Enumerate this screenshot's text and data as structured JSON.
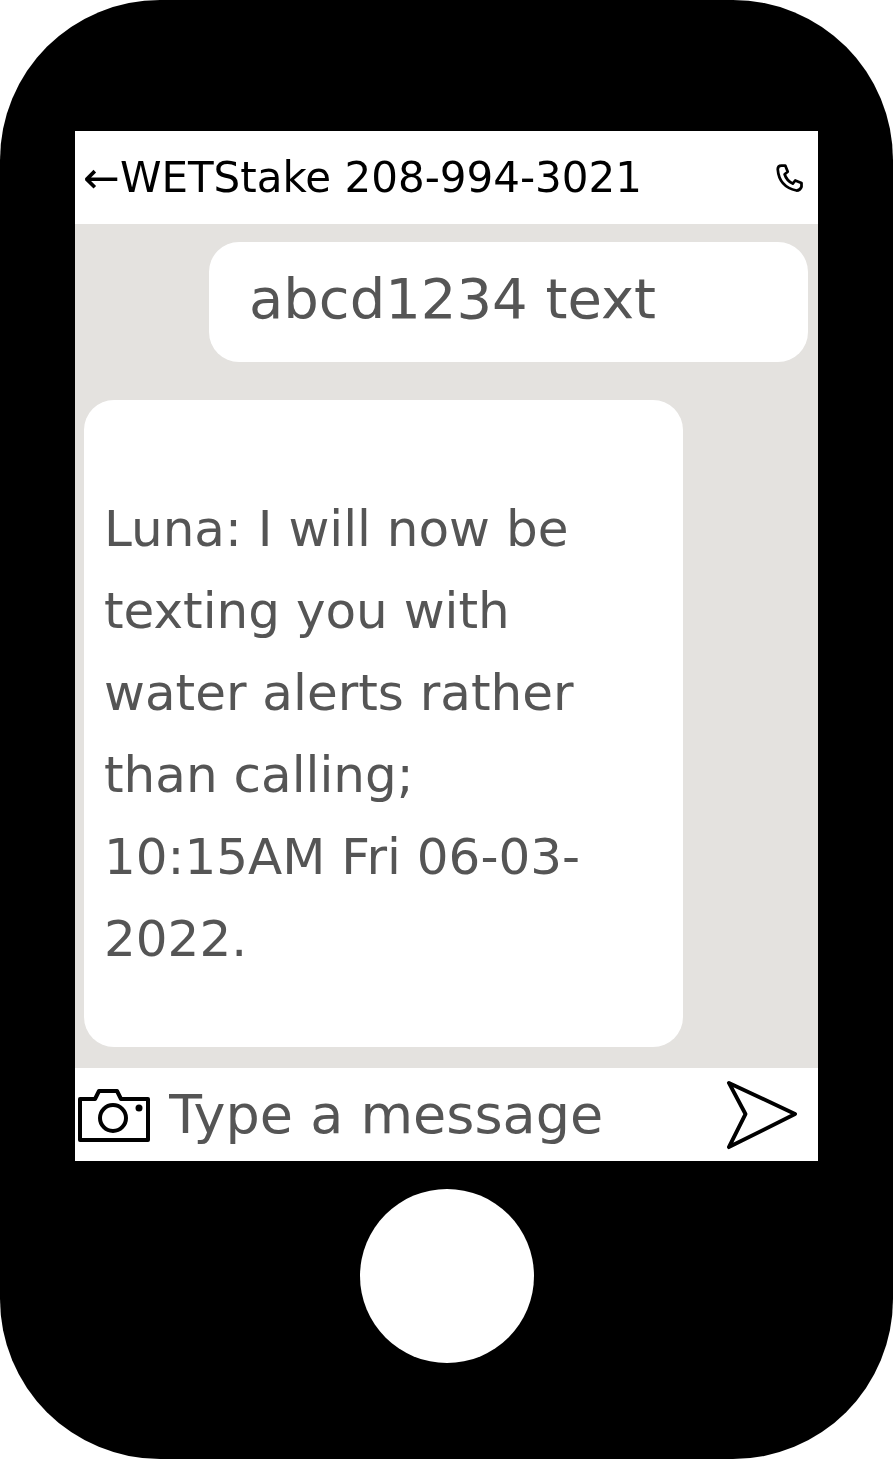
{
  "header": {
    "back": "←",
    "title": "WETStake 208-994-3021"
  },
  "messages": [
    {
      "kind": "outgoing",
      "text": "abcd1234 text"
    },
    {
      "kind": "incoming",
      "text": "Luna: I will now be texting you with water alerts rather than calling; 10:15AM Fri 06-03-2022."
    }
  ],
  "composer": {
    "placeholder": "Type a message"
  }
}
